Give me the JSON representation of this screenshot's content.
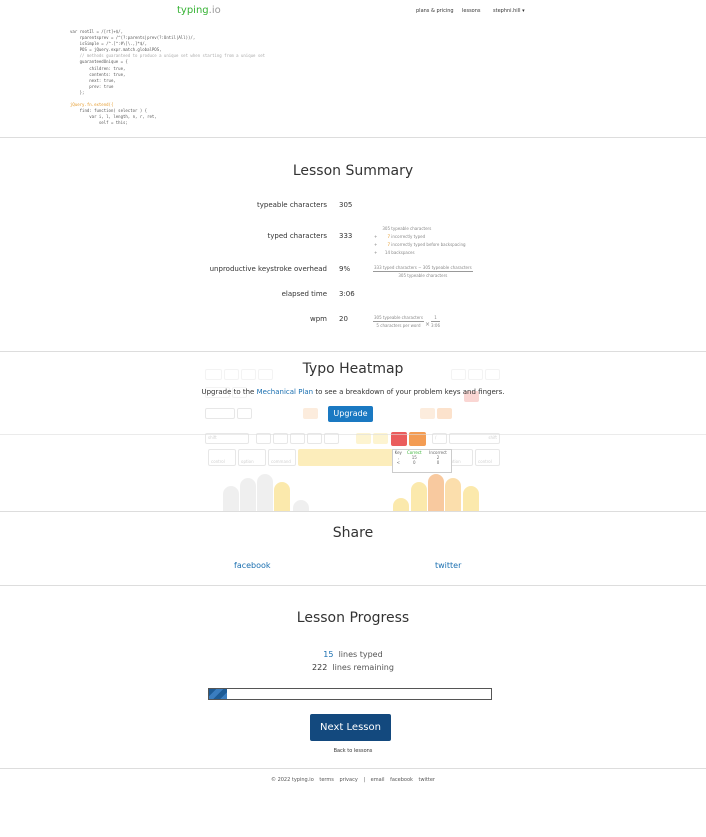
{
  "header": {
    "logo": "typing",
    "logo_tld": ".io",
    "nav": [
      "plans & pricing",
      "lessons"
    ],
    "user": "stephni.hill",
    "user_caret": "▾"
  },
  "code_snippet": [
    "var rootIl = /[rt]+$/,",
    "    rparentsprev = /^(?:parents|prev(?:Until|All))/,",
    "    isSimple = /^.[^:#\\[\\.,]*$/,",
    "    POS = jQuery.expr.match.globalPOS,",
    "    // methods guaranteed to produce a unique set when starting from a unique set",
    "    guaranteedUnique = {",
    "        children: true,",
    "        contents: true,",
    "        next: true,",
    "        prev: true",
    "    };",
    "",
    "jQuery.fn.extend({",
    "    find: function( selector ) {",
    "        var i, l, length, n, r, ret,",
    "            self = this;"
  ],
  "summary": {
    "title": "Lesson Summary",
    "rows": [
      {
        "label": "typeable characters",
        "value": "305"
      },
      {
        "label": "typed characters",
        "value": "333"
      },
      {
        "label": "unproductive keystroke overhead",
        "value": "9%"
      },
      {
        "label": "elapsed time",
        "value": "3:06"
      },
      {
        "label": "wpm",
        "value": "20"
      }
    ],
    "typed_breakdown": [
      {
        "sign": "",
        "num": "305",
        "text": "typeable characters"
      },
      {
        "sign": "+",
        "num": "7",
        "text": "incorrectly typed"
      },
      {
        "sign": "+",
        "num": "7",
        "text": "incorrectly typed before backspacing"
      },
      {
        "sign": "+",
        "num": "14",
        "text": "backspaces"
      }
    ],
    "overhead_num": "333 typed characters − 305 typeable characters",
    "overhead_den": "305 typeable characters",
    "wpm_num": "305 typeable characters",
    "wpm_den": "5 characters per word",
    "wpm_times": "×",
    "wpm_num2": "1",
    "wpm_den2": "3:06"
  },
  "heatmap": {
    "title": "Typo Heatmap",
    "upgrade_prefix": "Upgrade to the ",
    "upgrade_link": "Mechanical Plan",
    "upgrade_suffix": " to see a breakdown of your problem keys and fingers.",
    "upgrade_button": "Upgrade",
    "keys": {
      "shift": "shift",
      "shift_r": "shift",
      "control": "control",
      "option": "option",
      "command": "command",
      "control_r": "control",
      "option_r": "option",
      "slash": "/"
    },
    "tooltip": {
      "headers": [
        "Key",
        "Correct",
        "Incorrect"
      ],
      "rows": [
        [
          ",",
          "15",
          "2"
        ],
        [
          "<",
          "0",
          "0"
        ]
      ]
    }
  },
  "share": {
    "title": "Share",
    "facebook": "facebook",
    "twitter": "twitter"
  },
  "progress": {
    "title": "Lesson Progress",
    "lines_typed_num": "15",
    "lines_typed_text": "lines typed",
    "lines_remaining_num": "222",
    "lines_remaining_text": "lines remaining",
    "progress_fraction": 0.063,
    "next_button": "Next Lesson",
    "back_link": "Back to lessons"
  },
  "footer": {
    "copyright": "© 2022 typing.io",
    "links": [
      "terms",
      "privacy",
      "|",
      "email",
      "facebook",
      "twitter"
    ]
  },
  "colors": {
    "brand": "#35b233",
    "link": "#1a6fb0",
    "button": "#1a79c2",
    "next_button": "#13497e"
  }
}
